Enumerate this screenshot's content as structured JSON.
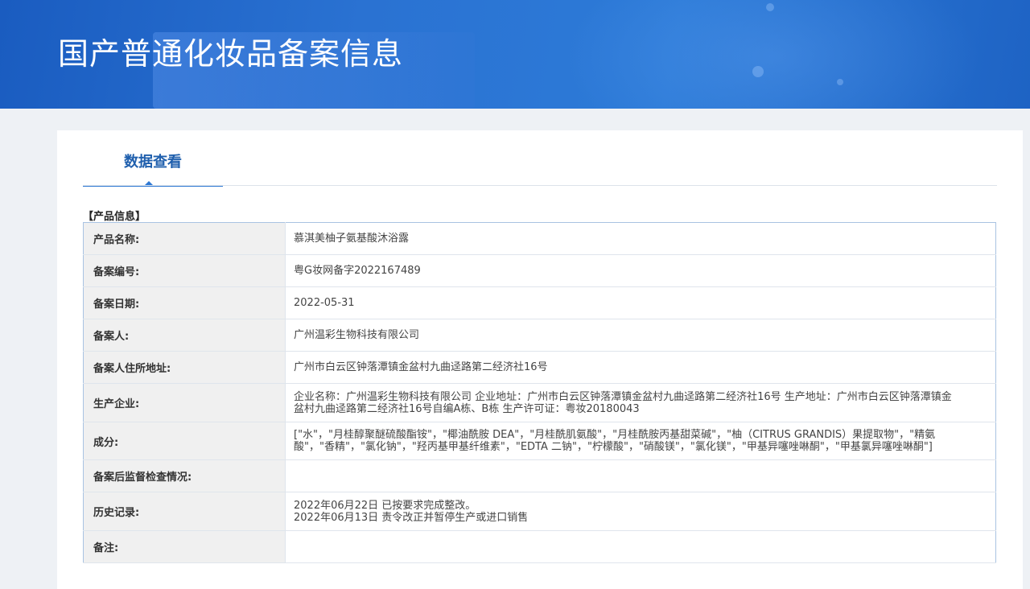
{
  "header": {
    "title": "国产普通化妆品备案信息"
  },
  "tabs": [
    {
      "label": "数据查看"
    }
  ],
  "section": {
    "label": "【产品信息】"
  },
  "product": {
    "rows": [
      {
        "label": "产品名称:",
        "value": "慕淇美柚子氨基酸沐浴露"
      },
      {
        "label": "备案编号:",
        "value": "粤G妆网备字2022167489"
      },
      {
        "label": "备案日期:",
        "value": "2022-05-31"
      },
      {
        "label": "备案人:",
        "value": "广州温彩生物科技有限公司"
      },
      {
        "label": "备案人住所地址:",
        "value": "广州市白云区钟落潭镇金盆村九曲迳路第二经济社16号"
      },
      {
        "label": "生产企业:",
        "value": "企业名称：广州温彩生物科技有限公司 企业地址：广州市白云区钟落潭镇金盆村九曲迳路第二经济社16号 生产地址：广州市白云区钟落潭镇金盆村九曲迳路第二经济社16号自编A栋、B栋 生产许可证：粤妆20180043"
      },
      {
        "label": "成分:",
        "value": "[\"水\"，\"月桂醇聚醚硫酸酯铵\"，\"椰油酰胺 DEA\"，\"月桂酰肌氨酸\"，\"月桂酰胺丙基甜菜碱\"，\"柚（CITRUS GRANDIS）果提取物\"，\"精氨酸\"，\"香精\"，\"氯化钠\"，\"羟丙基甲基纤维素\"，\"EDTA 二钠\"，\"柠檬酸\"，\"硝酸镁\"，\"氯化镁\"，\"甲基异噻唑啉酮\"，\"甲基氯异噻唑啉酮\"]"
      },
      {
        "label": "备案后监督检查情况:",
        "value": ""
      },
      {
        "label": "历史记录:",
        "value_lines": [
          "2022年06月22日 已按要求完成整改。",
          "2022年06月13日 责令改正并暂停生产或进口销售"
        ]
      },
      {
        "label": "备注:",
        "value": ""
      }
    ]
  }
}
